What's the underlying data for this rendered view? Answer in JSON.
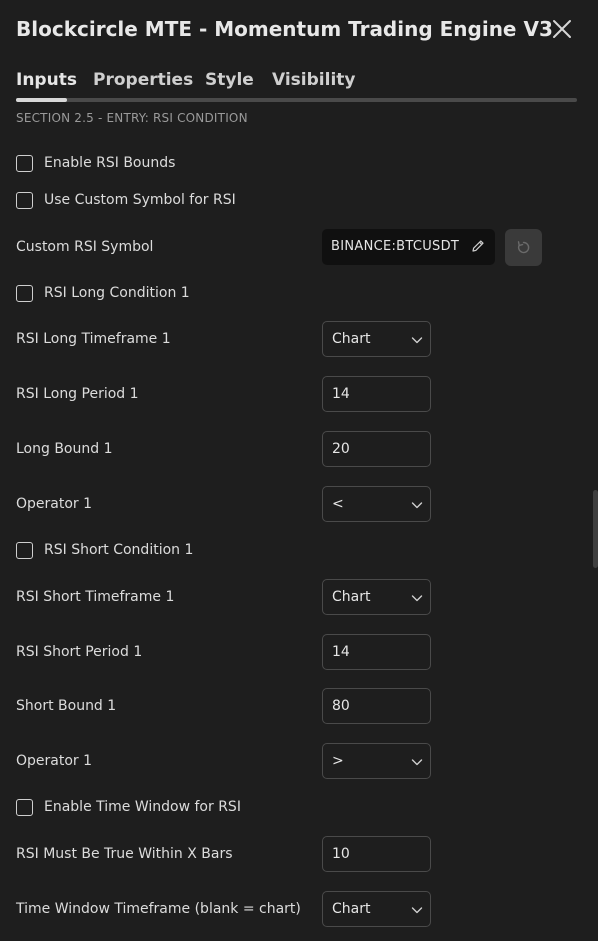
{
  "dialog": {
    "title": "Blockcircle MTE - Momentum Trading Engine V3"
  },
  "tabs": [
    {
      "label": "Inputs",
      "active": true
    },
    {
      "label": "Properties"
    },
    {
      "label": "Style"
    },
    {
      "label": "Visibility"
    }
  ],
  "section": {
    "title": "SECTION 2.5 - ENTRY: RSI CONDITION"
  },
  "rows": {
    "enable_rsi_bounds": {
      "label": "Enable RSI Bounds",
      "checked": false
    },
    "use_custom_symbol": {
      "label": "Use Custom Symbol for RSI",
      "checked": false
    },
    "custom_rsi_symbol": {
      "label": "Custom RSI Symbol",
      "value": "BINANCE:BTCUSDT"
    },
    "rsi_long_condition_1": {
      "label": "RSI Long Condition 1",
      "checked": false
    },
    "rsi_long_timeframe_1": {
      "label": "RSI Long Timeframe 1",
      "value": "Chart"
    },
    "rsi_long_period_1": {
      "label": "RSI Long Period 1",
      "value": "14"
    },
    "long_bound_1": {
      "label": "Long Bound 1",
      "value": "20"
    },
    "long_operator_1": {
      "label": "Operator 1",
      "value": "<"
    },
    "rsi_short_condition_1": {
      "label": "RSI Short Condition 1",
      "checked": false
    },
    "rsi_short_timeframe_1": {
      "label": "RSI Short Timeframe 1",
      "value": "Chart"
    },
    "rsi_short_period_1": {
      "label": "RSI Short Period 1",
      "value": "14"
    },
    "short_bound_1": {
      "label": "Short Bound 1",
      "value": "80"
    },
    "short_operator_1": {
      "label": "Operator 1",
      "value": ">"
    },
    "enable_time_window": {
      "label": "Enable Time Window for RSI",
      "checked": false
    },
    "rsi_within_x_bars": {
      "label": "RSI Must Be True Within X Bars",
      "value": "10"
    },
    "time_window_timeframe": {
      "label": "Time Window Timeframe (blank = chart)",
      "value": "Chart"
    }
  },
  "icons": {
    "close": "close-icon",
    "chevron": "chevron-down-icon",
    "edit": "pencil-icon",
    "reset": "reset-icon"
  }
}
